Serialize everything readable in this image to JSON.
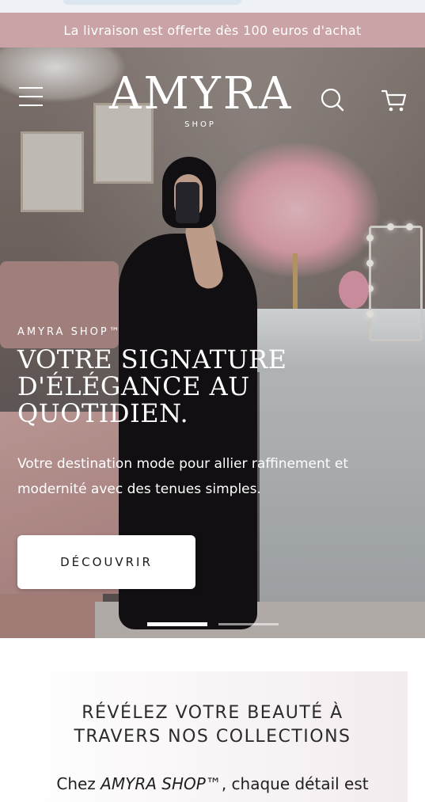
{
  "announcement": "La livraison est offerte dès 100 euros d'achat",
  "header": {
    "logo_text": "AMYRA",
    "logo_subtext": "SHOP"
  },
  "hero": {
    "eyebrow": "AMYRA SHOP™",
    "headline_lines": [
      "VOTRE SIGNATURE",
      "D'ÉLÉGANCE AU",
      "QUOTIDIEN."
    ],
    "description_lines": [
      "Votre destination mode pour allier raffinement et",
      "modernité avec des tenues simples."
    ],
    "cta_label": "DÉCOUVRIR",
    "slides_total": 2,
    "active_slide": 1
  },
  "collections": {
    "title_lines": [
      "RÉVÉLEZ VOTRE BEAUTÉ À",
      "TRAVERS NOS COLLECTIONS"
    ],
    "body_prefix": "Chez ",
    "body_brand": "AMYRA SHOP™",
    "body_suffix": ", chaque détail est"
  },
  "colors": {
    "announcement_bg": "#c9a3a5",
    "hero_text": "#ffffff",
    "cta_bg": "#ffffff"
  },
  "icons": [
    "menu-icon",
    "search-icon",
    "cart-icon"
  ]
}
